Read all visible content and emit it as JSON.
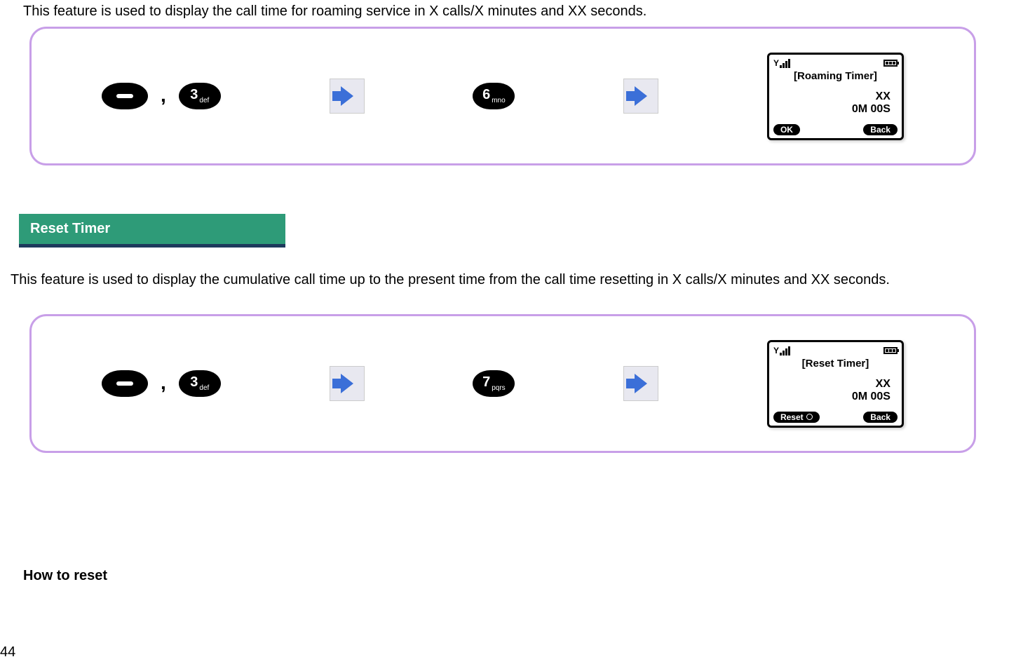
{
  "intro": "This feature is used to display the call time for roaming service in X calls/X minutes and XX seconds.",
  "section1": {
    "keyA_number": "3",
    "keyA_sub": "def",
    "keyB_number": "6",
    "keyB_sub": "mno",
    "screen": {
      "title": "[Roaming Timer]",
      "line1": "XX",
      "line2": "0M 00S",
      "soft_left": "OK",
      "soft_right": "Back"
    }
  },
  "header_reset": "Reset Timer",
  "desc_reset": "This feature is used to display the cumulative call time up to the present time from the call time resetting in X calls/X minutes and XX seconds.",
  "section2": {
    "keyA_number": "3",
    "keyA_sub": "def",
    "keyB_number": "7",
    "keyB_sub": "pqrs",
    "screen": {
      "title": "[Reset Timer]",
      "line1": "XX",
      "line2": "0M 00S",
      "soft_left": "Reset",
      "soft_right": "Back"
    }
  },
  "how_to_reset": "How to reset",
  "page_number": "44"
}
